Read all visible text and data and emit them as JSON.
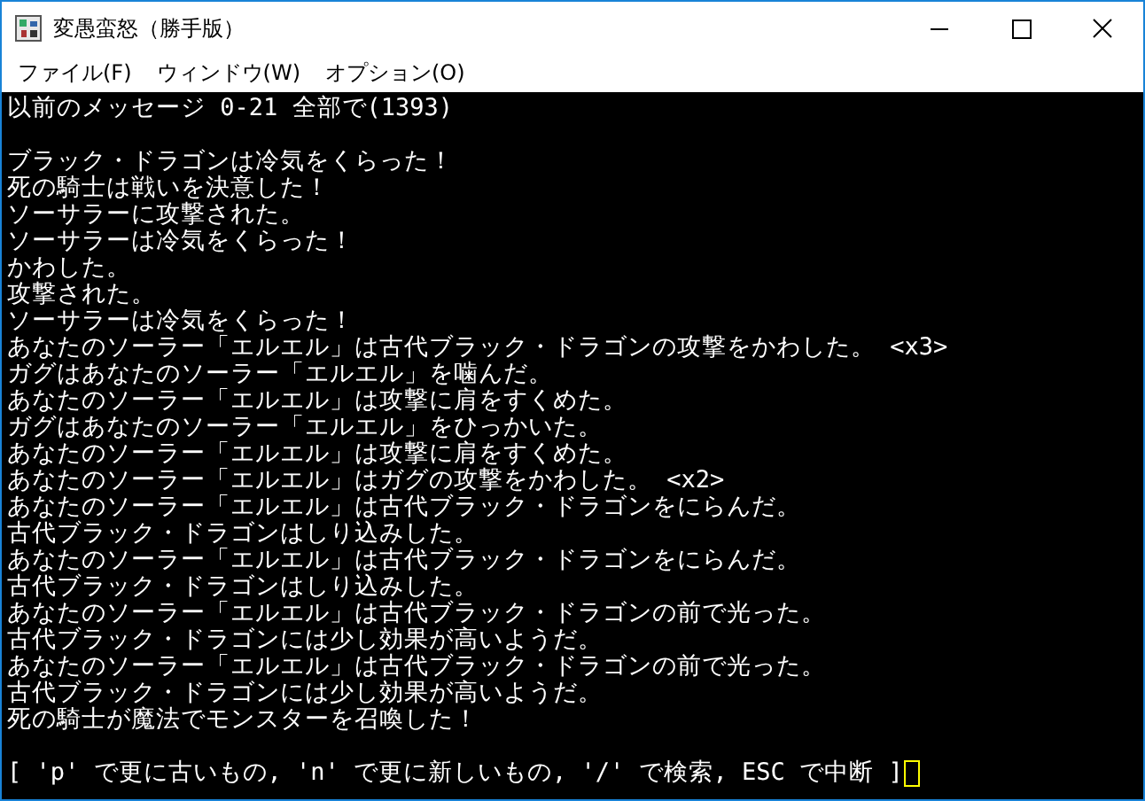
{
  "window": {
    "title": "変愚蛮怒（勝手版）"
  },
  "menu": [
    "ファイル(F)",
    "ウィンドウ(W)",
    "オプション(O)"
  ],
  "terminal": {
    "header": "以前のメッセージ 0-21 全部で(1393)",
    "lines": [
      "ブラック・ドラゴンは冷気をくらった！",
      "死の騎士は戦いを決意した！",
      "ソーサラーに攻撃された。",
      "ソーサラーは冷気をくらった！",
      "かわした。",
      "攻撃された。",
      "ソーサラーは冷気をくらった！",
      "あなたのソーラー「エルエル」は古代ブラック・ドラゴンの攻撃をかわした。 <x3>",
      "ガグはあなたのソーラー「エルエル」を噛んだ。",
      "あなたのソーラー「エルエル」は攻撃に肩をすくめた。",
      "ガグはあなたのソーラー「エルエル」をひっかいた。",
      "あなたのソーラー「エルエル」は攻撃に肩をすくめた。",
      "あなたのソーラー「エルエル」はガグの攻撃をかわした。 <x2>",
      "あなたのソーラー「エルエル」は古代ブラック・ドラゴンをにらんだ。",
      "古代ブラック・ドラゴンはしり込みした。",
      "あなたのソーラー「エルエル」は古代ブラック・ドラゴンをにらんだ。",
      "古代ブラック・ドラゴンはしり込みした。",
      "あなたのソーラー「エルエル」は古代ブラック・ドラゴンの前で光った。",
      "古代ブラック・ドラゴンには少し効果が高いようだ。",
      "あなたのソーラー「エルエル」は古代ブラック・ドラゴンの前で光った。",
      "古代ブラック・ドラゴンには少し効果が高いようだ。",
      "死の騎士が魔法でモンスターを召喚した！"
    ],
    "prompt": "[ 'p' で更に古いもの, 'n' で更に新しいもの, '/' で検索, ESC で中断 ]"
  }
}
